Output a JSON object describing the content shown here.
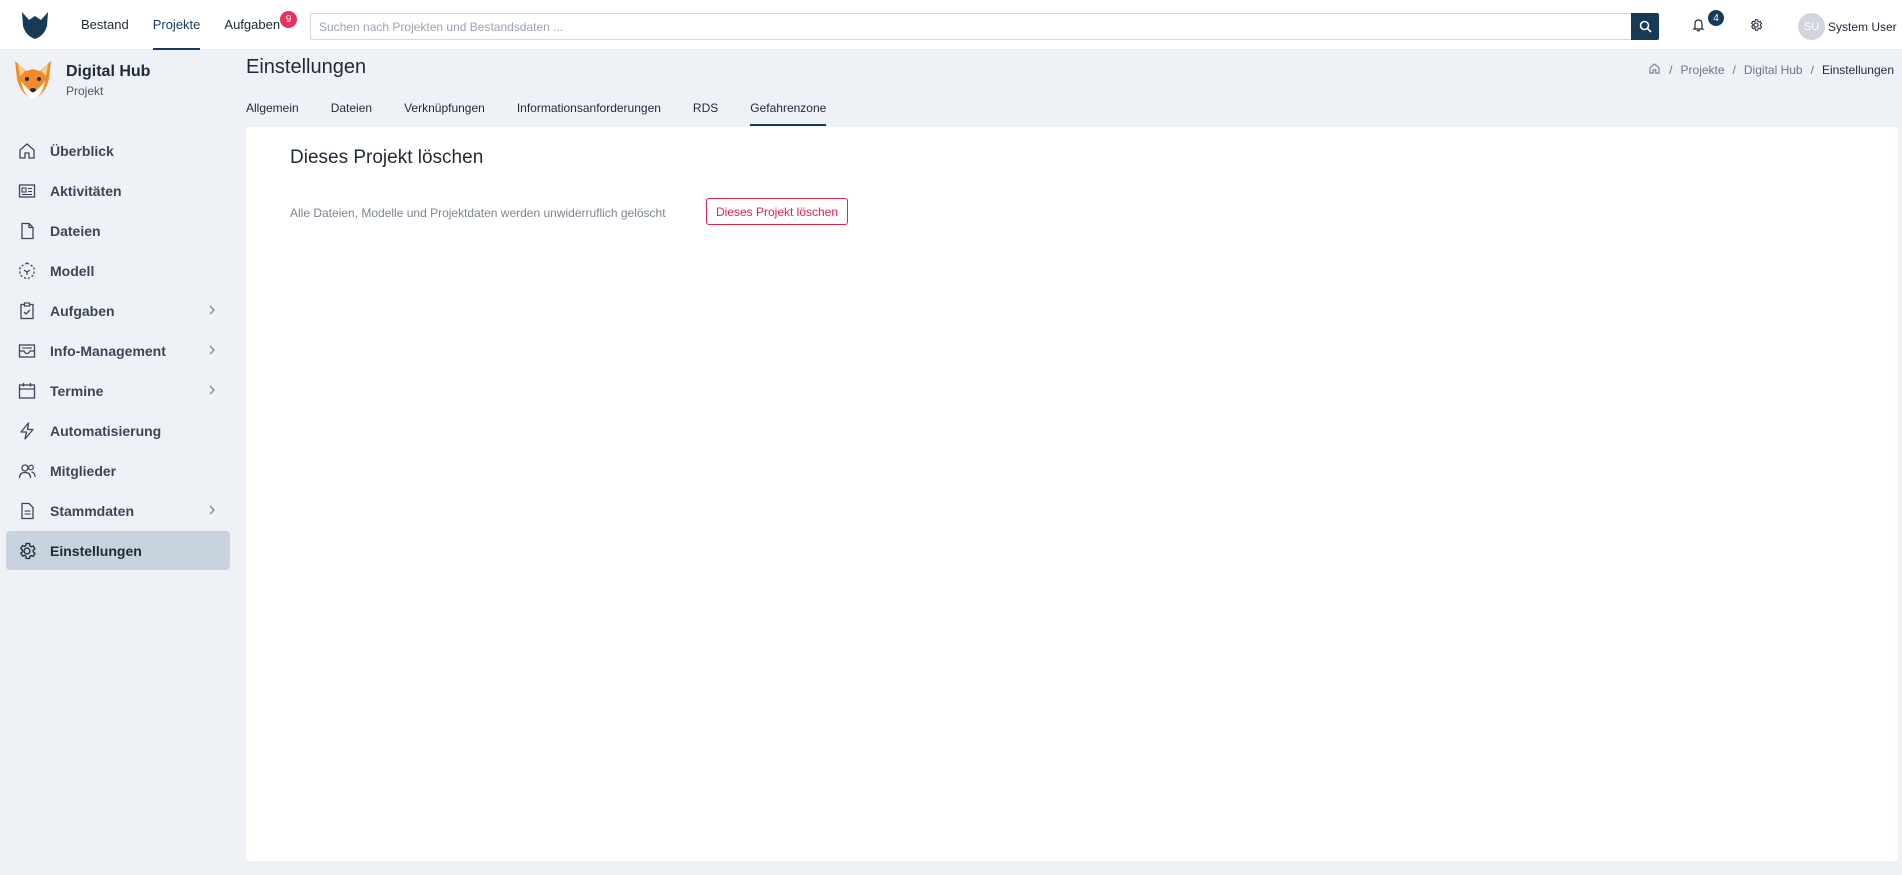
{
  "topnav": {
    "items": [
      {
        "label": "Bestand"
      },
      {
        "label": "Projekte"
      },
      {
        "label": "Aufgaben",
        "badge": "9"
      }
    ]
  },
  "search": {
    "placeholder": "Suchen nach Projekten und Bestandsdaten ..."
  },
  "notifications": {
    "count": "4"
  },
  "user": {
    "initials": "SU",
    "name": "System User"
  },
  "project": {
    "name": "Digital Hub",
    "type": "Projekt"
  },
  "sidebar": {
    "items": [
      {
        "label": "Überblick",
        "icon": "home-icon"
      },
      {
        "label": "Aktivitäten",
        "icon": "newspaper-icon"
      },
      {
        "label": "Dateien",
        "icon": "file-icon"
      },
      {
        "label": "Modell",
        "icon": "cube-icon"
      },
      {
        "label": "Aufgaben",
        "icon": "clipboard-check-icon",
        "expandable": true
      },
      {
        "label": "Info-Management",
        "icon": "inbox-icon",
        "expandable": true
      },
      {
        "label": "Termine",
        "icon": "calendar-icon",
        "expandable": true
      },
      {
        "label": "Automatisierung",
        "icon": "bolt-icon"
      },
      {
        "label": "Mitglieder",
        "icon": "users-icon"
      },
      {
        "label": "Stammdaten",
        "icon": "document-icon",
        "expandable": true
      },
      {
        "label": "Einstellungen",
        "icon": "gear-icon",
        "active": true
      }
    ]
  },
  "page": {
    "title": "Einstellungen"
  },
  "breadcrumb": {
    "items": [
      "Projekte",
      "Digital Hub",
      "Einstellungen"
    ]
  },
  "tabs": [
    {
      "label": "Allgemein"
    },
    {
      "label": "Dateien"
    },
    {
      "label": "Verknüpfungen"
    },
    {
      "label": "Informationsanforderungen"
    },
    {
      "label": "RDS"
    },
    {
      "label": "Gefahrenzone",
      "active": true
    }
  ],
  "danger": {
    "heading": "Dieses Projekt löschen",
    "description": "Alle Dateien, Modelle und Projektdaten werden unwiderruflich gelöscht",
    "button_label": "Dieses Projekt löschen"
  },
  "colors": {
    "accent": "#173a56",
    "danger": "#e0234d",
    "badge": "#e8325b",
    "background": "#eef2f7",
    "active_item": "#c9d3df"
  }
}
